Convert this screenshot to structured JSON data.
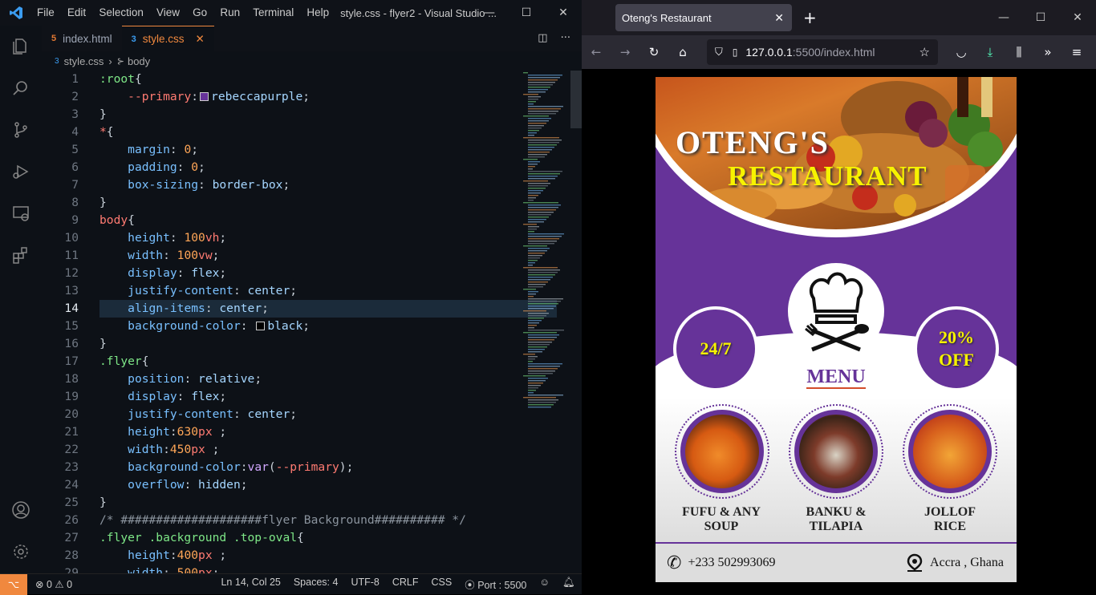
{
  "vscode": {
    "menu": [
      "File",
      "Edit",
      "Selection",
      "View",
      "Go",
      "Run",
      "Terminal",
      "Help"
    ],
    "window_title": "style.css - flyer2 - Visual Studio ...",
    "tabs": [
      {
        "label": "index.html"
      },
      {
        "label": "style.css"
      }
    ],
    "breadcrumb": {
      "file": "style.css",
      "node": "body"
    },
    "lines": [
      {
        "n": "1",
        "tokens": [
          [
            "sel",
            ":root"
          ],
          [
            "punc",
            "{"
          ]
        ]
      },
      {
        "n": "2",
        "tokens": [
          [
            "plain",
            "    "
          ],
          [
            "kw",
            "--primary"
          ],
          [
            "punc",
            ":"
          ],
          [
            "swatch",
            "#663399"
          ],
          [
            "val",
            "rebeccapurple"
          ],
          [
            "punc",
            ";"
          ]
        ]
      },
      {
        "n": "3",
        "tokens": [
          [
            "punc",
            "}"
          ]
        ]
      },
      {
        "n": "4",
        "tokens": [
          [
            "kw",
            "*"
          ],
          [
            "punc",
            "{"
          ]
        ]
      },
      {
        "n": "5",
        "tokens": [
          [
            "plain",
            "    "
          ],
          [
            "prop",
            "margin"
          ],
          [
            "punc",
            ": "
          ],
          [
            "num",
            "0"
          ],
          [
            "punc",
            ";"
          ]
        ]
      },
      {
        "n": "6",
        "tokens": [
          [
            "plain",
            "    "
          ],
          [
            "prop",
            "padding"
          ],
          [
            "punc",
            ": "
          ],
          [
            "num",
            "0"
          ],
          [
            "punc",
            ";"
          ]
        ]
      },
      {
        "n": "7",
        "tokens": [
          [
            "plain",
            "    "
          ],
          [
            "prop",
            "box-sizing"
          ],
          [
            "punc",
            ": "
          ],
          [
            "val",
            "border-box"
          ],
          [
            "punc",
            ";"
          ]
        ]
      },
      {
        "n": "8",
        "tokens": [
          [
            "punc",
            "}"
          ]
        ]
      },
      {
        "n": "9",
        "tokens": [
          [
            "kw",
            "body"
          ],
          [
            "punc",
            "{"
          ]
        ]
      },
      {
        "n": "10",
        "tokens": [
          [
            "plain",
            "    "
          ],
          [
            "prop",
            "height"
          ],
          [
            "punc",
            ": "
          ],
          [
            "num",
            "100"
          ],
          [
            "unit",
            "vh"
          ],
          [
            "punc",
            ";"
          ]
        ]
      },
      {
        "n": "11",
        "tokens": [
          [
            "plain",
            "    "
          ],
          [
            "prop",
            "width"
          ],
          [
            "punc",
            ": "
          ],
          [
            "num",
            "100"
          ],
          [
            "unit",
            "vw"
          ],
          [
            "punc",
            ";"
          ]
        ]
      },
      {
        "n": "12",
        "tokens": [
          [
            "plain",
            "    "
          ],
          [
            "prop",
            "display"
          ],
          [
            "punc",
            ": "
          ],
          [
            "val",
            "flex"
          ],
          [
            "punc",
            ";"
          ]
        ]
      },
      {
        "n": "13",
        "tokens": [
          [
            "plain",
            "    "
          ],
          [
            "prop",
            "justify-content"
          ],
          [
            "punc",
            ": "
          ],
          [
            "val",
            "center"
          ],
          [
            "punc",
            ";"
          ]
        ]
      },
      {
        "n": "14",
        "tokens": [
          [
            "plain",
            "    "
          ],
          [
            "prop",
            "align-items"
          ],
          [
            "punc",
            ": "
          ],
          [
            "val",
            "center"
          ],
          [
            "punc",
            ";"
          ]
        ]
      },
      {
        "n": "15",
        "tokens": [
          [
            "plain",
            "    "
          ],
          [
            "prop",
            "background-color"
          ],
          [
            "punc",
            ": "
          ],
          [
            "swatch",
            "#000000"
          ],
          [
            "val",
            "black"
          ],
          [
            "punc",
            ";"
          ]
        ]
      },
      {
        "n": "16",
        "tokens": [
          [
            "punc",
            "}"
          ]
        ]
      },
      {
        "n": "17",
        "tokens": [
          [
            "sel",
            ".flyer"
          ],
          [
            "punc",
            "{"
          ]
        ]
      },
      {
        "n": "18",
        "tokens": [
          [
            "plain",
            "    "
          ],
          [
            "prop",
            "position"
          ],
          [
            "punc",
            ": "
          ],
          [
            "val",
            "relative"
          ],
          [
            "punc",
            ";"
          ]
        ]
      },
      {
        "n": "19",
        "tokens": [
          [
            "plain",
            "    "
          ],
          [
            "prop",
            "display"
          ],
          [
            "punc",
            ": "
          ],
          [
            "val",
            "flex"
          ],
          [
            "punc",
            ";"
          ]
        ]
      },
      {
        "n": "20",
        "tokens": [
          [
            "plain",
            "    "
          ],
          [
            "prop",
            "justify-content"
          ],
          [
            "punc",
            ": "
          ],
          [
            "val",
            "center"
          ],
          [
            "punc",
            ";"
          ]
        ]
      },
      {
        "n": "21",
        "tokens": [
          [
            "plain",
            "    "
          ],
          [
            "prop",
            "height"
          ],
          [
            "punc",
            ":"
          ],
          [
            "num",
            "630"
          ],
          [
            "unit",
            "px"
          ],
          [
            "punc",
            " ;"
          ]
        ]
      },
      {
        "n": "22",
        "tokens": [
          [
            "plain",
            "    "
          ],
          [
            "prop",
            "width"
          ],
          [
            "punc",
            ":"
          ],
          [
            "num",
            "450"
          ],
          [
            "unit",
            "px"
          ],
          [
            "punc",
            " ;"
          ]
        ]
      },
      {
        "n": "23",
        "tokens": [
          [
            "plain",
            "    "
          ],
          [
            "prop",
            "background-color"
          ],
          [
            "punc",
            ":"
          ],
          [
            "func",
            "var"
          ],
          [
            "punc",
            "("
          ],
          [
            "kw",
            "--primary"
          ],
          [
            "punc",
            ");"
          ]
        ]
      },
      {
        "n": "24",
        "tokens": [
          [
            "plain",
            "    "
          ],
          [
            "prop",
            "overflow"
          ],
          [
            "punc",
            ": "
          ],
          [
            "val",
            "hidden"
          ],
          [
            "punc",
            ";"
          ]
        ]
      },
      {
        "n": "25",
        "tokens": [
          [
            "punc",
            "}"
          ]
        ]
      },
      {
        "n": "26",
        "tokens": [
          [
            "cmt",
            "/* ####################flyer Background########## */"
          ]
        ]
      },
      {
        "n": "27",
        "tokens": [
          [
            "sel",
            ".flyer .background .top-oval"
          ],
          [
            "punc",
            "{"
          ]
        ]
      },
      {
        "n": "28",
        "tokens": [
          [
            "plain",
            "    "
          ],
          [
            "prop",
            "height"
          ],
          [
            "punc",
            ":"
          ],
          [
            "num",
            "400"
          ],
          [
            "unit",
            "px"
          ],
          [
            "punc",
            " ;"
          ]
        ]
      },
      {
        "n": "29",
        "tokens": [
          [
            "plain",
            "    "
          ],
          [
            "prop",
            "width"
          ],
          [
            "punc",
            ": "
          ],
          [
            "num",
            "500"
          ],
          [
            "unit",
            "px"
          ],
          [
            "punc",
            ";"
          ]
        ]
      }
    ],
    "current_line": "14",
    "status": {
      "problems": "0",
      "warnings": "0",
      "position": "Ln 14, Col 25",
      "spaces": "Spaces: 4",
      "encoding": "UTF-8",
      "eol": "CRLF",
      "language": "CSS",
      "port": "Port : 5500"
    }
  },
  "firefox": {
    "tab_title": "Oteng's Restaurant",
    "url_host": "127.0.0.1",
    "url_rest": ":5500/index.html"
  },
  "flyer": {
    "brand_line1": "OTENG'S",
    "brand_line2": "RESTAURANT",
    "left_badge": "24/7",
    "right_badge_1": "20%",
    "right_badge_2": "OFF",
    "menu_label": "MENU",
    "dishes": [
      {
        "line1": "FUFU & ANY",
        "line2": "SOUP"
      },
      {
        "line1": "BANKU &",
        "line2": "TILAPIA"
      },
      {
        "line1": "JOLLOF",
        "line2": "RICE"
      }
    ],
    "phone": "+233 502993069",
    "location": "Accra , Ghana"
  },
  "colors": {
    "primary": "#663399",
    "accent": "#f0883e",
    "badge_text": "#f7f200"
  }
}
